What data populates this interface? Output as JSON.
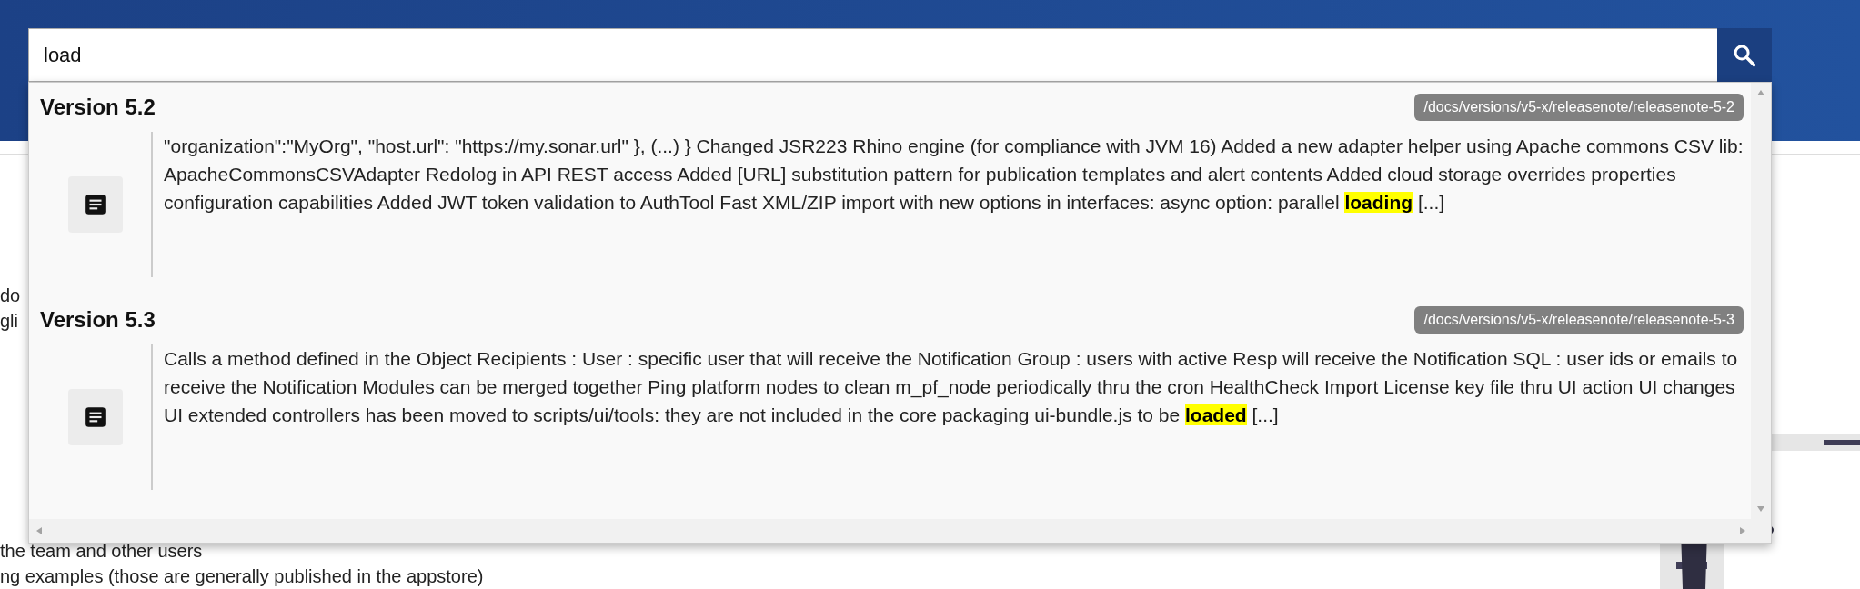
{
  "search": {
    "value": "load"
  },
  "results": [
    {
      "title": "Version 5.2",
      "path": "/docs/versions/v5-x/releasenote/releasenote-5-2",
      "snippet": "\"organization\":\"MyOrg\", \"host.url\": \"https://my.sonar.url\" }, (...) } Changed JSR223 Rhino engine (for compliance with JVM 16) Added a new adapter helper using Apache commons CSV lib: ApacheCommonsCSVAdapter Redolog in API REST access Added [URL] substitution pattern for publication templates and alert contents Added cloud storage overrides properties configuration capabilities Added JWT token validation to AuthTool Fast XML/ZIP import with new options in interfaces: async option: parallel **loading** [...]"
    },
    {
      "title": "Version 5.3",
      "path": "/docs/versions/v5-x/releasenote/releasenote-5-3",
      "snippet": "Calls a method defined in the Object Recipients : User : specific user that will receive the Notification Group : users with active Resp will receive the Notification SQL : user ids or emails to receive the Notification Modules can be merged together Ping platform nodes to clean m_pf_node periodically thru the cron HealthCheck Import License key file thru UI action UI changes UI extended controllers has been moved to scripts/ui/tools: they are not included in the core packaging ui-bundle.js to be **loaded** [...]"
    }
  ],
  "page_text": {
    "top": [
      "do",
      "gli"
    ],
    "bottom": [
      "the team and other users",
      "ng examples (those are generally published in the appstore)"
    ]
  }
}
